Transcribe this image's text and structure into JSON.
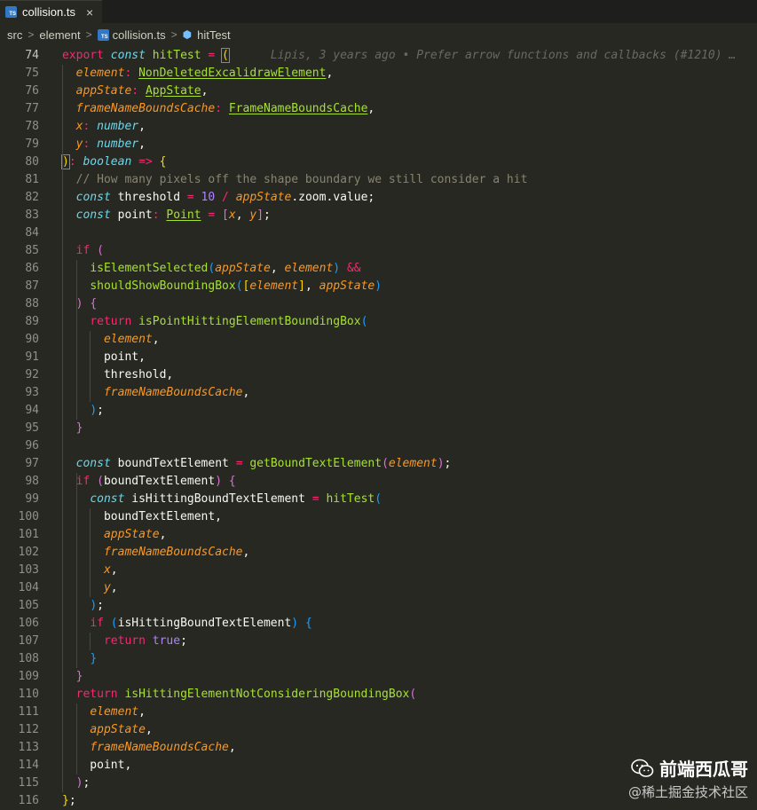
{
  "tab": {
    "filename": "collision.ts",
    "badge": "TS",
    "close": "×"
  },
  "breadcrumb": {
    "path": [
      "src",
      "element",
      "collision.ts",
      "hitTest"
    ],
    "sep": ">"
  },
  "blame": "Lipis, 3 years ago • Prefer arrow functions and callbacks (#1210) …",
  "lines": [
    {
      "n": "74",
      "t": [
        [
          "kw",
          "export"
        ],
        [
          "p",
          " "
        ],
        [
          "st",
          "const"
        ],
        [
          "p",
          " "
        ],
        [
          "fn",
          "hitTest"
        ],
        [
          "p",
          " "
        ],
        [
          "kw",
          "="
        ],
        [
          "p",
          " "
        ],
        [
          "y1 match",
          "("
        ]
      ]
    },
    {
      "n": "75",
      "t": [
        [
          "p",
          "  "
        ],
        [
          "pm",
          "element"
        ],
        [
          "kw",
          ":"
        ],
        [
          "p",
          " "
        ],
        [
          "ty",
          "NonDeletedExcalidrawElement"
        ],
        [
          "p",
          ","
        ]
      ]
    },
    {
      "n": "76",
      "t": [
        [
          "p",
          "  "
        ],
        [
          "pm",
          "appState"
        ],
        [
          "kw",
          ":"
        ],
        [
          "p",
          " "
        ],
        [
          "ty",
          "AppState"
        ],
        [
          "p",
          ","
        ]
      ]
    },
    {
      "n": "77",
      "t": [
        [
          "p",
          "  "
        ],
        [
          "pm",
          "frameNameBoundsCache"
        ],
        [
          "kw",
          ":"
        ],
        [
          "p",
          " "
        ],
        [
          "ty",
          "FrameNameBoundsCache"
        ],
        [
          "p",
          ","
        ]
      ]
    },
    {
      "n": "78",
      "t": [
        [
          "p",
          "  "
        ],
        [
          "pm",
          "x"
        ],
        [
          "kw",
          ":"
        ],
        [
          "p",
          " "
        ],
        [
          "st",
          "number"
        ],
        [
          "p",
          ","
        ]
      ]
    },
    {
      "n": "79",
      "t": [
        [
          "p",
          "  "
        ],
        [
          "pm",
          "y"
        ],
        [
          "kw",
          ":"
        ],
        [
          "p",
          " "
        ],
        [
          "st",
          "number"
        ],
        [
          "p",
          ","
        ]
      ]
    },
    {
      "n": "80",
      "t": [
        [
          "y1 match",
          ")"
        ],
        [
          "kw",
          ":"
        ],
        [
          "p",
          " "
        ],
        [
          "st",
          "boolean"
        ],
        [
          "p",
          " "
        ],
        [
          "kw",
          "=>"
        ],
        [
          "p",
          " "
        ],
        [
          "y1",
          "{"
        ]
      ]
    },
    {
      "n": "81",
      "t": [
        [
          "p",
          "  "
        ],
        [
          "cm",
          "// How many pixels off the shape boundary we still consider a hit"
        ]
      ]
    },
    {
      "n": "82",
      "t": [
        [
          "p",
          "  "
        ],
        [
          "st",
          "const"
        ],
        [
          "p",
          " threshold "
        ],
        [
          "kw",
          "="
        ],
        [
          "p",
          " "
        ],
        [
          "num",
          "10"
        ],
        [
          "p",
          " "
        ],
        [
          "kw",
          "/"
        ],
        [
          "p",
          " "
        ],
        [
          "pm",
          "appState"
        ],
        [
          "p",
          ".zoom.value;"
        ]
      ]
    },
    {
      "n": "83",
      "t": [
        [
          "p",
          "  "
        ],
        [
          "st",
          "const"
        ],
        [
          "p",
          " point"
        ],
        [
          "kw",
          ":"
        ],
        [
          "p",
          " "
        ],
        [
          "ty",
          "Point"
        ],
        [
          "p",
          " "
        ],
        [
          "kw",
          "="
        ],
        [
          "p",
          " "
        ],
        [
          "m1",
          "["
        ],
        [
          "pm",
          "x"
        ],
        [
          "p",
          ", "
        ],
        [
          "pm",
          "y"
        ],
        [
          "m1",
          "]"
        ],
        [
          "p",
          ";"
        ]
      ]
    },
    {
      "n": "84",
      "t": []
    },
    {
      "n": "85",
      "t": [
        [
          "p",
          "  "
        ],
        [
          "kw",
          "if"
        ],
        [
          "p",
          " "
        ],
        [
          "m1",
          "("
        ]
      ]
    },
    {
      "n": "86",
      "t": [
        [
          "p",
          "    "
        ],
        [
          "fn",
          "isElementSelected"
        ],
        [
          "b1",
          "("
        ],
        [
          "pm",
          "appState"
        ],
        [
          "p",
          ", "
        ],
        [
          "pm",
          "element"
        ],
        [
          "b1",
          ")"
        ],
        [
          "p",
          " "
        ],
        [
          "kw",
          "&&"
        ]
      ]
    },
    {
      "n": "87",
      "t": [
        [
          "p",
          "    "
        ],
        [
          "fn",
          "shouldShowBoundingBox"
        ],
        [
          "b1",
          "("
        ],
        [
          "y1",
          "["
        ],
        [
          "pm",
          "element"
        ],
        [
          "y1",
          "]"
        ],
        [
          "p",
          ", "
        ],
        [
          "pm",
          "appState"
        ],
        [
          "b1",
          ")"
        ]
      ]
    },
    {
      "n": "88",
      "t": [
        [
          "p",
          "  "
        ],
        [
          "m1",
          ")"
        ],
        [
          "p",
          " "
        ],
        [
          "m1",
          "{"
        ]
      ]
    },
    {
      "n": "89",
      "t": [
        [
          "p",
          "    "
        ],
        [
          "kw",
          "return"
        ],
        [
          "p",
          " "
        ],
        [
          "fn",
          "isPointHittingElementBoundingBox"
        ],
        [
          "b1",
          "("
        ]
      ]
    },
    {
      "n": "90",
      "t": [
        [
          "p",
          "      "
        ],
        [
          "pm",
          "element"
        ],
        [
          "p",
          ","
        ]
      ]
    },
    {
      "n": "91",
      "t": [
        [
          "p",
          "      point,"
        ]
      ]
    },
    {
      "n": "92",
      "t": [
        [
          "p",
          "      threshold,"
        ]
      ]
    },
    {
      "n": "93",
      "t": [
        [
          "p",
          "      "
        ],
        [
          "pm",
          "frameNameBoundsCache"
        ],
        [
          "p",
          ","
        ]
      ]
    },
    {
      "n": "94",
      "t": [
        [
          "p",
          "    "
        ],
        [
          "b1",
          ")"
        ],
        [
          "p",
          ";"
        ]
      ]
    },
    {
      "n": "95",
      "t": [
        [
          "p",
          "  "
        ],
        [
          "m1",
          "}"
        ]
      ]
    },
    {
      "n": "96",
      "t": []
    },
    {
      "n": "97",
      "t": [
        [
          "p",
          "  "
        ],
        [
          "st",
          "const"
        ],
        [
          "p",
          " boundTextElement "
        ],
        [
          "kw",
          "="
        ],
        [
          "p",
          " "
        ],
        [
          "fn",
          "getBoundTextElement"
        ],
        [
          "m1",
          "("
        ],
        [
          "pm",
          "element"
        ],
        [
          "m1",
          ")"
        ],
        [
          "p",
          ";"
        ]
      ]
    },
    {
      "n": "98",
      "t": [
        [
          "p",
          "  "
        ],
        [
          "kw",
          "if"
        ],
        [
          "p",
          " "
        ],
        [
          "m1",
          "("
        ],
        [
          "p",
          "boundTextElement"
        ],
        [
          "m1",
          ")"
        ],
        [
          "p",
          " "
        ],
        [
          "m1",
          "{"
        ]
      ]
    },
    {
      "n": "99",
      "t": [
        [
          "p",
          "    "
        ],
        [
          "st",
          "const"
        ],
        [
          "p",
          " isHittingBoundTextElement "
        ],
        [
          "kw",
          "="
        ],
        [
          "p",
          " "
        ],
        [
          "fn",
          "hitTest"
        ],
        [
          "b1",
          "("
        ]
      ]
    },
    {
      "n": "100",
      "t": [
        [
          "p",
          "      boundTextElement,"
        ]
      ]
    },
    {
      "n": "101",
      "t": [
        [
          "p",
          "      "
        ],
        [
          "pm",
          "appState"
        ],
        [
          "p",
          ","
        ]
      ]
    },
    {
      "n": "102",
      "t": [
        [
          "p",
          "      "
        ],
        [
          "pm",
          "frameNameBoundsCache"
        ],
        [
          "p",
          ","
        ]
      ]
    },
    {
      "n": "103",
      "t": [
        [
          "p",
          "      "
        ],
        [
          "pm",
          "x"
        ],
        [
          "p",
          ","
        ]
      ]
    },
    {
      "n": "104",
      "t": [
        [
          "p",
          "      "
        ],
        [
          "pm",
          "y"
        ],
        [
          "p",
          ","
        ]
      ]
    },
    {
      "n": "105",
      "t": [
        [
          "p",
          "    "
        ],
        [
          "b1",
          ")"
        ],
        [
          "p",
          ";"
        ]
      ]
    },
    {
      "n": "106",
      "t": [
        [
          "p",
          "    "
        ],
        [
          "kw",
          "if"
        ],
        [
          "p",
          " "
        ],
        [
          "b1",
          "("
        ],
        [
          "p",
          "isHittingBoundTextElement"
        ],
        [
          "b1",
          ")"
        ],
        [
          "p",
          " "
        ],
        [
          "b1",
          "{"
        ]
      ]
    },
    {
      "n": "107",
      "t": [
        [
          "p",
          "      "
        ],
        [
          "kw",
          "return"
        ],
        [
          "p",
          " "
        ],
        [
          "bool",
          "true"
        ],
        [
          "p",
          ";"
        ]
      ]
    },
    {
      "n": "108",
      "t": [
        [
          "p",
          "    "
        ],
        [
          "b1",
          "}"
        ]
      ]
    },
    {
      "n": "109",
      "t": [
        [
          "p",
          "  "
        ],
        [
          "m1",
          "}"
        ]
      ]
    },
    {
      "n": "110",
      "t": [
        [
          "p",
          "  "
        ],
        [
          "kw",
          "return"
        ],
        [
          "p",
          " "
        ],
        [
          "fn",
          "isHittingElementNotConsideringBoundingBox"
        ],
        [
          "m1",
          "("
        ]
      ]
    },
    {
      "n": "111",
      "t": [
        [
          "p",
          "    "
        ],
        [
          "pm",
          "element"
        ],
        [
          "p",
          ","
        ]
      ]
    },
    {
      "n": "112",
      "t": [
        [
          "p",
          "    "
        ],
        [
          "pm",
          "appState"
        ],
        [
          "p",
          ","
        ]
      ]
    },
    {
      "n": "113",
      "t": [
        [
          "p",
          "    "
        ],
        [
          "pm",
          "frameNameBoundsCache"
        ],
        [
          "p",
          ","
        ]
      ]
    },
    {
      "n": "114",
      "t": [
        [
          "p",
          "    point,"
        ]
      ]
    },
    {
      "n": "115",
      "t": [
        [
          "p",
          "  "
        ],
        [
          "m1",
          ")"
        ],
        [
          "p",
          ";"
        ]
      ]
    },
    {
      "n": "116",
      "t": [
        [
          "y1",
          "}"
        ],
        [
          "p",
          ";"
        ]
      ]
    }
  ],
  "watermark": {
    "title": "前端西瓜哥",
    "subtitle": "@稀土掘金技术社区"
  },
  "colors": {
    "background": "#272822",
    "keyword": "#f92672",
    "function": "#a6e22e",
    "param": "#fd971f",
    "storage": "#66d9ef",
    "number": "#ae81ff",
    "comment": "#88846f"
  }
}
